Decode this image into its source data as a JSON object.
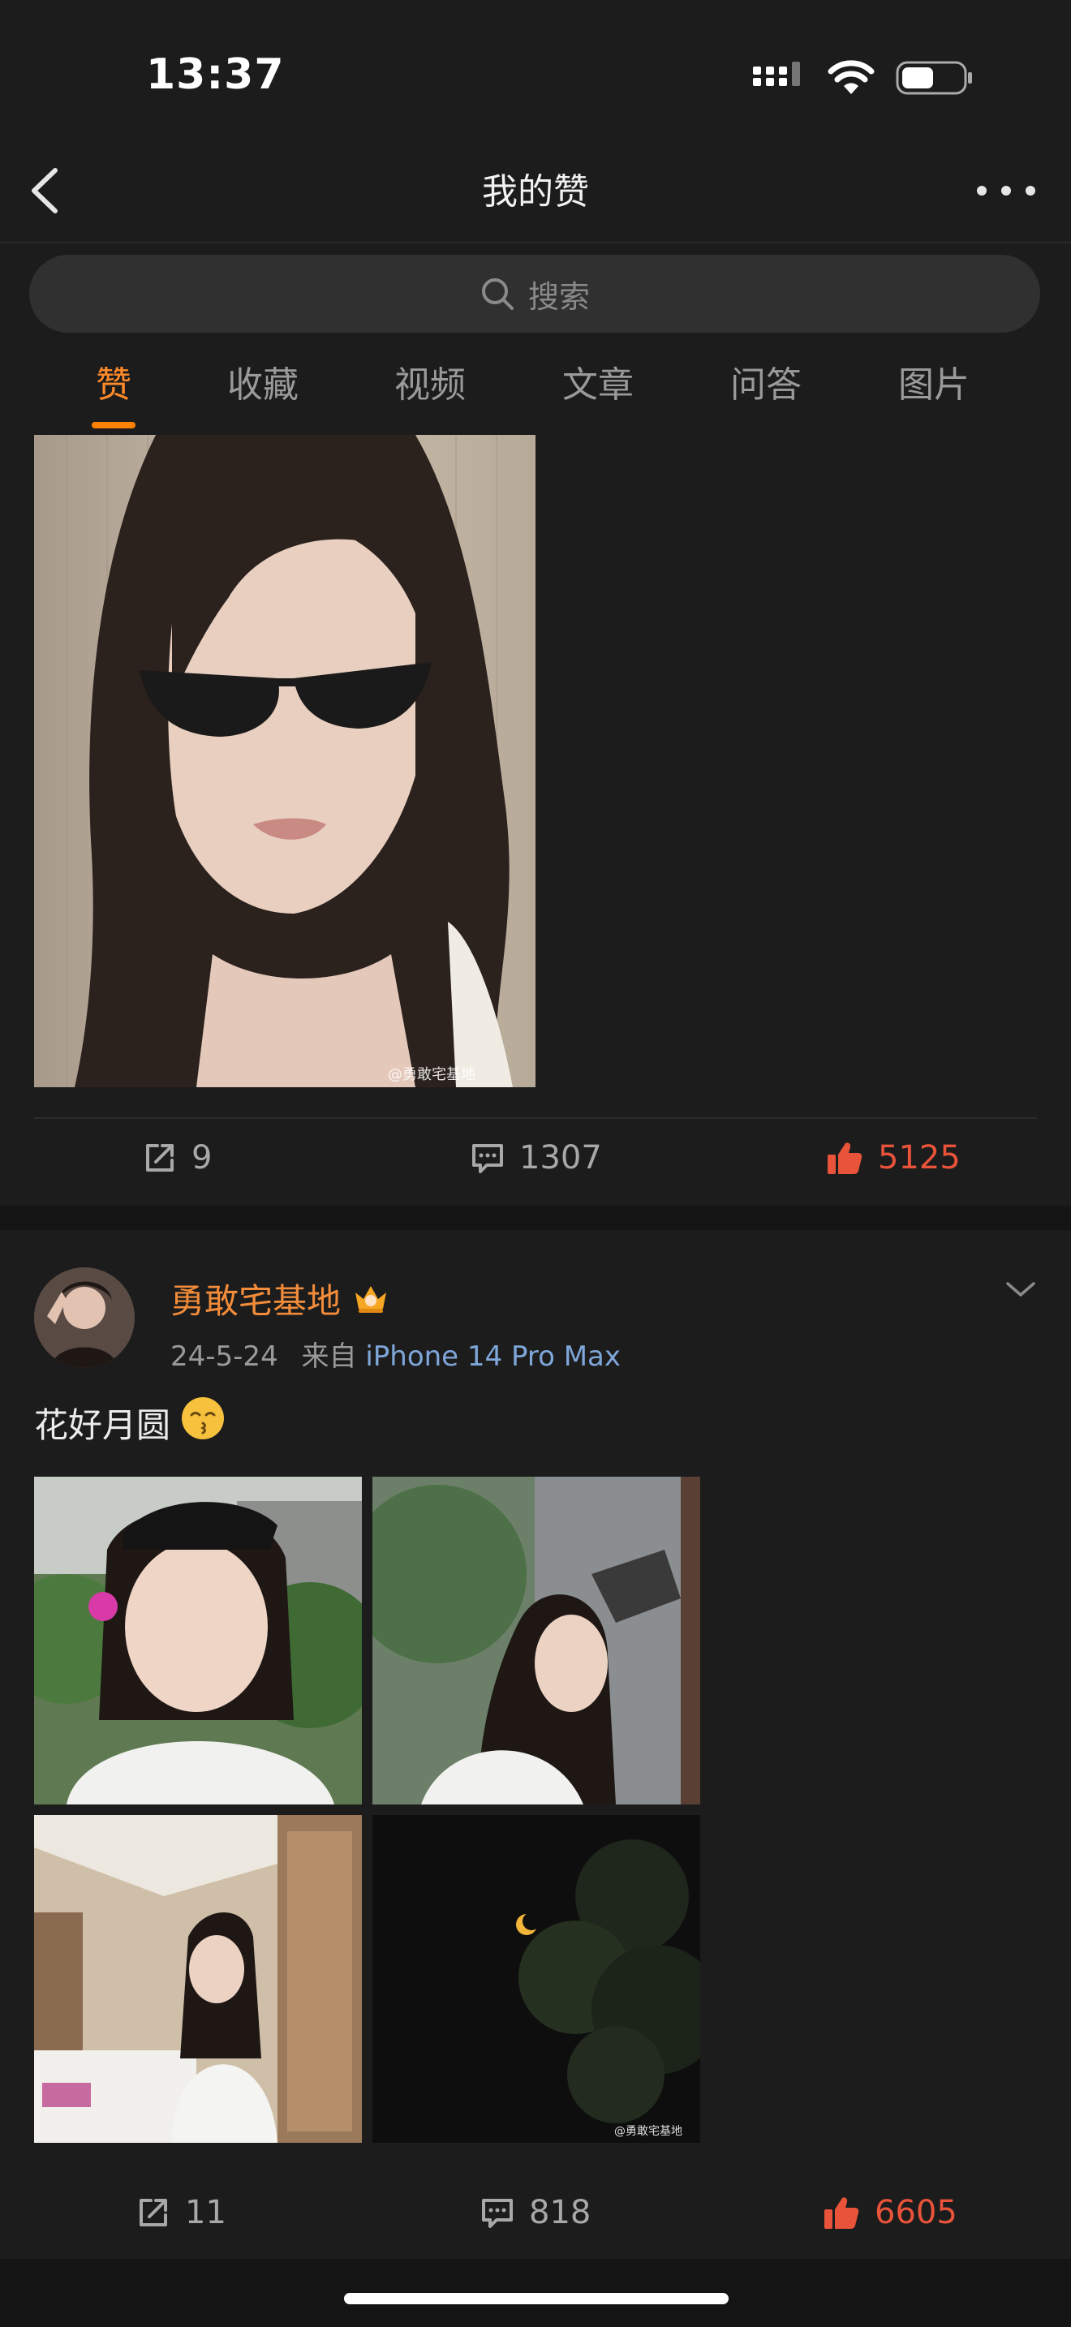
{
  "status_bar": {
    "time": "13:37"
  },
  "nav": {
    "title": "我的赞"
  },
  "search": {
    "placeholder": "搜索"
  },
  "tabs": [
    {
      "label": "赞",
      "active": true
    },
    {
      "label": "收藏",
      "active": false
    },
    {
      "label": "视频",
      "active": false
    },
    {
      "label": "文章",
      "active": false
    },
    {
      "label": "问答",
      "active": false
    },
    {
      "label": "图片",
      "active": false
    }
  ],
  "post1": {
    "photo_watermark": "@勇敢宅基地",
    "actions": {
      "reposts": "9",
      "comments": "1307",
      "likes": "5125"
    }
  },
  "post2": {
    "username": "勇敢宅基地",
    "date": "24-5-24",
    "source_prefix": "来自",
    "source": "iPhone 14 Pro Max",
    "text": "花好月圆",
    "emoji": "😙",
    "photo_watermark": "@勇敢宅基地",
    "actions": {
      "reposts": "11",
      "comments": "818",
      "likes": "6605"
    }
  },
  "colors": {
    "accent": "#ff8200",
    "liked": "#e8533a",
    "username": "#f28c3a",
    "source_link": "#7fa6d9",
    "background": "#1c1c1c"
  },
  "icons": [
    "back-icon",
    "more-icon",
    "search-icon",
    "repost-icon",
    "comment-icon",
    "like-icon",
    "chevron-down-icon",
    "crown-badge-icon"
  ]
}
